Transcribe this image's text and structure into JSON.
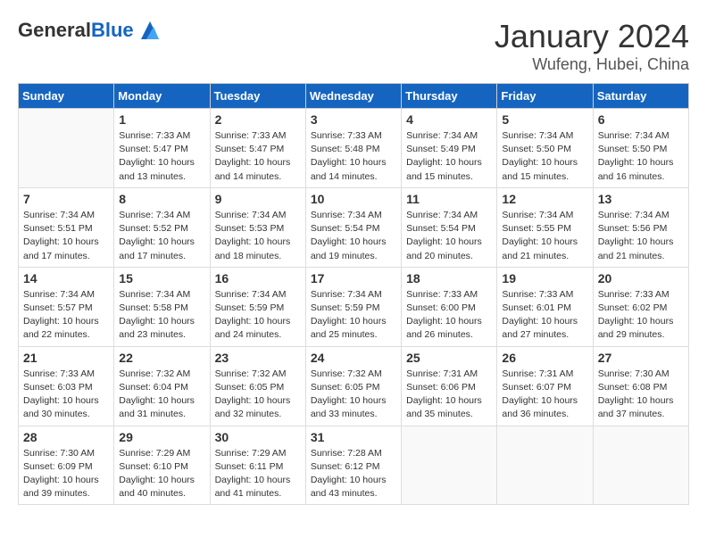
{
  "header": {
    "logo_general": "General",
    "logo_blue": "Blue",
    "month": "January 2024",
    "location": "Wufeng, Hubei, China"
  },
  "days_of_week": [
    "Sunday",
    "Monday",
    "Tuesday",
    "Wednesday",
    "Thursday",
    "Friday",
    "Saturday"
  ],
  "weeks": [
    [
      {
        "day": "",
        "info": ""
      },
      {
        "day": "1",
        "info": "Sunrise: 7:33 AM\nSunset: 5:47 PM\nDaylight: 10 hours\nand 13 minutes."
      },
      {
        "day": "2",
        "info": "Sunrise: 7:33 AM\nSunset: 5:47 PM\nDaylight: 10 hours\nand 14 minutes."
      },
      {
        "day": "3",
        "info": "Sunrise: 7:33 AM\nSunset: 5:48 PM\nDaylight: 10 hours\nand 14 minutes."
      },
      {
        "day": "4",
        "info": "Sunrise: 7:34 AM\nSunset: 5:49 PM\nDaylight: 10 hours\nand 15 minutes."
      },
      {
        "day": "5",
        "info": "Sunrise: 7:34 AM\nSunset: 5:50 PM\nDaylight: 10 hours\nand 15 minutes."
      },
      {
        "day": "6",
        "info": "Sunrise: 7:34 AM\nSunset: 5:50 PM\nDaylight: 10 hours\nand 16 minutes."
      }
    ],
    [
      {
        "day": "7",
        "info": "Sunrise: 7:34 AM\nSunset: 5:51 PM\nDaylight: 10 hours\nand 17 minutes."
      },
      {
        "day": "8",
        "info": "Sunrise: 7:34 AM\nSunset: 5:52 PM\nDaylight: 10 hours\nand 17 minutes."
      },
      {
        "day": "9",
        "info": "Sunrise: 7:34 AM\nSunset: 5:53 PM\nDaylight: 10 hours\nand 18 minutes."
      },
      {
        "day": "10",
        "info": "Sunrise: 7:34 AM\nSunset: 5:54 PM\nDaylight: 10 hours\nand 19 minutes."
      },
      {
        "day": "11",
        "info": "Sunrise: 7:34 AM\nSunset: 5:54 PM\nDaylight: 10 hours\nand 20 minutes."
      },
      {
        "day": "12",
        "info": "Sunrise: 7:34 AM\nSunset: 5:55 PM\nDaylight: 10 hours\nand 21 minutes."
      },
      {
        "day": "13",
        "info": "Sunrise: 7:34 AM\nSunset: 5:56 PM\nDaylight: 10 hours\nand 21 minutes."
      }
    ],
    [
      {
        "day": "14",
        "info": "Sunrise: 7:34 AM\nSunset: 5:57 PM\nDaylight: 10 hours\nand 22 minutes."
      },
      {
        "day": "15",
        "info": "Sunrise: 7:34 AM\nSunset: 5:58 PM\nDaylight: 10 hours\nand 23 minutes."
      },
      {
        "day": "16",
        "info": "Sunrise: 7:34 AM\nSunset: 5:59 PM\nDaylight: 10 hours\nand 24 minutes."
      },
      {
        "day": "17",
        "info": "Sunrise: 7:34 AM\nSunset: 5:59 PM\nDaylight: 10 hours\nand 25 minutes."
      },
      {
        "day": "18",
        "info": "Sunrise: 7:33 AM\nSunset: 6:00 PM\nDaylight: 10 hours\nand 26 minutes."
      },
      {
        "day": "19",
        "info": "Sunrise: 7:33 AM\nSunset: 6:01 PM\nDaylight: 10 hours\nand 27 minutes."
      },
      {
        "day": "20",
        "info": "Sunrise: 7:33 AM\nSunset: 6:02 PM\nDaylight: 10 hours\nand 29 minutes."
      }
    ],
    [
      {
        "day": "21",
        "info": "Sunrise: 7:33 AM\nSunset: 6:03 PM\nDaylight: 10 hours\nand 30 minutes."
      },
      {
        "day": "22",
        "info": "Sunrise: 7:32 AM\nSunset: 6:04 PM\nDaylight: 10 hours\nand 31 minutes."
      },
      {
        "day": "23",
        "info": "Sunrise: 7:32 AM\nSunset: 6:05 PM\nDaylight: 10 hours\nand 32 minutes."
      },
      {
        "day": "24",
        "info": "Sunrise: 7:32 AM\nSunset: 6:05 PM\nDaylight: 10 hours\nand 33 minutes."
      },
      {
        "day": "25",
        "info": "Sunrise: 7:31 AM\nSunset: 6:06 PM\nDaylight: 10 hours\nand 35 minutes."
      },
      {
        "day": "26",
        "info": "Sunrise: 7:31 AM\nSunset: 6:07 PM\nDaylight: 10 hours\nand 36 minutes."
      },
      {
        "day": "27",
        "info": "Sunrise: 7:30 AM\nSunset: 6:08 PM\nDaylight: 10 hours\nand 37 minutes."
      }
    ],
    [
      {
        "day": "28",
        "info": "Sunrise: 7:30 AM\nSunset: 6:09 PM\nDaylight: 10 hours\nand 39 minutes."
      },
      {
        "day": "29",
        "info": "Sunrise: 7:29 AM\nSunset: 6:10 PM\nDaylight: 10 hours\nand 40 minutes."
      },
      {
        "day": "30",
        "info": "Sunrise: 7:29 AM\nSunset: 6:11 PM\nDaylight: 10 hours\nand 41 minutes."
      },
      {
        "day": "31",
        "info": "Sunrise: 7:28 AM\nSunset: 6:12 PM\nDaylight: 10 hours\nand 43 minutes."
      },
      {
        "day": "",
        "info": ""
      },
      {
        "day": "",
        "info": ""
      },
      {
        "day": "",
        "info": ""
      }
    ]
  ]
}
